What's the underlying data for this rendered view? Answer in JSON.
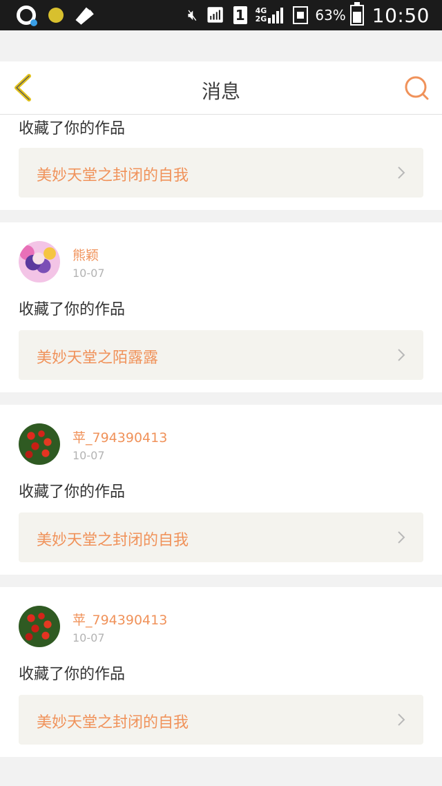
{
  "status_bar": {
    "sim_label": "1",
    "network_top": "4G",
    "network_bottom": "2G",
    "battery": "63%",
    "time": "10:50"
  },
  "header": {
    "title": "消息"
  },
  "colors": {
    "accent": "#f0925a",
    "back_icon": "#e2c21c"
  },
  "messages": [
    {
      "action": "收藏了你的作品",
      "work": "美妙天堂之封闭的自我"
    },
    {
      "user": "熊颖",
      "date": "10-07",
      "action": "收藏了你的作品",
      "work": "美妙天堂之陌露露"
    },
    {
      "user": "苹_794390413",
      "date": "10-07",
      "action": "收藏了你的作品",
      "work": "美妙天堂之封闭的自我"
    },
    {
      "user": "苹_794390413",
      "date": "10-07",
      "action": "收藏了你的作品",
      "work": "美妙天堂之封闭的自我"
    }
  ]
}
